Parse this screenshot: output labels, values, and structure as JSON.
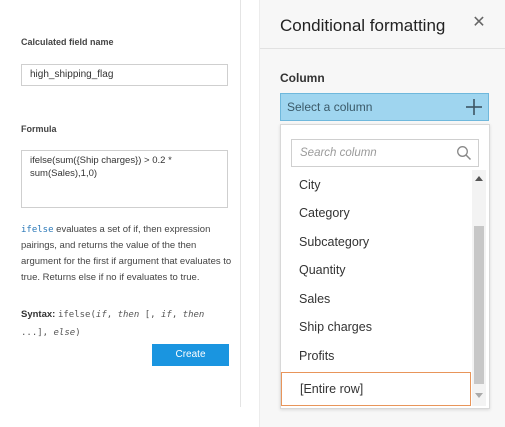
{
  "left": {
    "calc_field_label": "Calculated field name",
    "calc_field_value": "high_shipping_flag",
    "formula_label": "Formula",
    "formula_value": "ifelse(sum({Ship charges}) > 0.2 *\nsum(Sales),1,0)",
    "desc_func": "ifelse",
    "desc_text": " evaluates a set of if, then expression pairings, and returns the value of the then argument for the first if argument that evaluates to true. Returns else if no if evaluates to true.",
    "syntax_label": "Syntax:",
    "syntax_prefix": "ifelse(",
    "syntax_if": "if",
    "syntax_sep1": ", ",
    "syntax_then": "then",
    "syntax_mid": " [, ",
    "syntax_if2": "if",
    "syntax_sep2": ", ",
    "syntax_then2": "then",
    "syntax_line2a": "...], ",
    "syntax_else": "else",
    "syntax_end": ")",
    "create_label": "Create"
  },
  "panel": {
    "title": "Conditional formatting",
    "close": "✕",
    "column_label": "Column",
    "select_placeholder": "Select a column",
    "search_placeholder": "Search column",
    "items": [
      "City",
      "Category",
      "Subcategory",
      "Quantity",
      "Sales",
      "Ship charges",
      "Profits"
    ],
    "entire_row": "[Entire row]"
  },
  "colors": {
    "accent": "#1a95e0",
    "select_bg": "#9fd5ef",
    "highlight_border": "#e8955a"
  },
  "icons": {
    "plus": "plus-icon",
    "search": "search-icon",
    "close": "close-icon"
  }
}
